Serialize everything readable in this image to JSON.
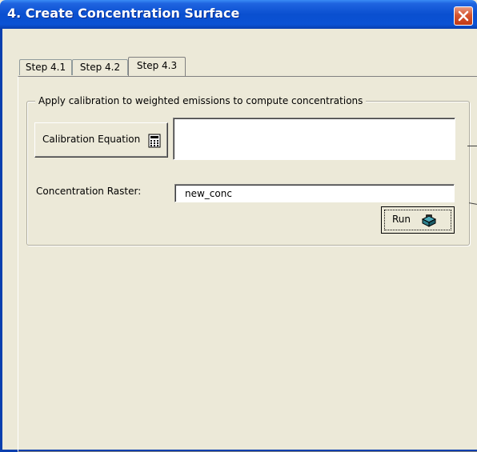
{
  "window": {
    "title": "4. Create Concentration Surface"
  },
  "tabs": [
    {
      "label": "Step 4.1",
      "active": false
    },
    {
      "label": "Step 4.2",
      "active": false
    },
    {
      "label": "Step 4.3",
      "active": true
    }
  ],
  "group": {
    "legend": "Apply calibration to weighted emissions to compute concentrations",
    "calibration_button": "Calibration Equation",
    "calibration_icon": "calculator-icon",
    "equation_value": "",
    "raster_label": "Concentration Raster:",
    "raster_value": "new_conc",
    "run_button": "Run",
    "run_icon": "toolbox-icon"
  },
  "colors": {
    "titlebar": "#0a4fd0",
    "close_button": "#d6552f",
    "dialog_bg": "#ece9d8"
  }
}
